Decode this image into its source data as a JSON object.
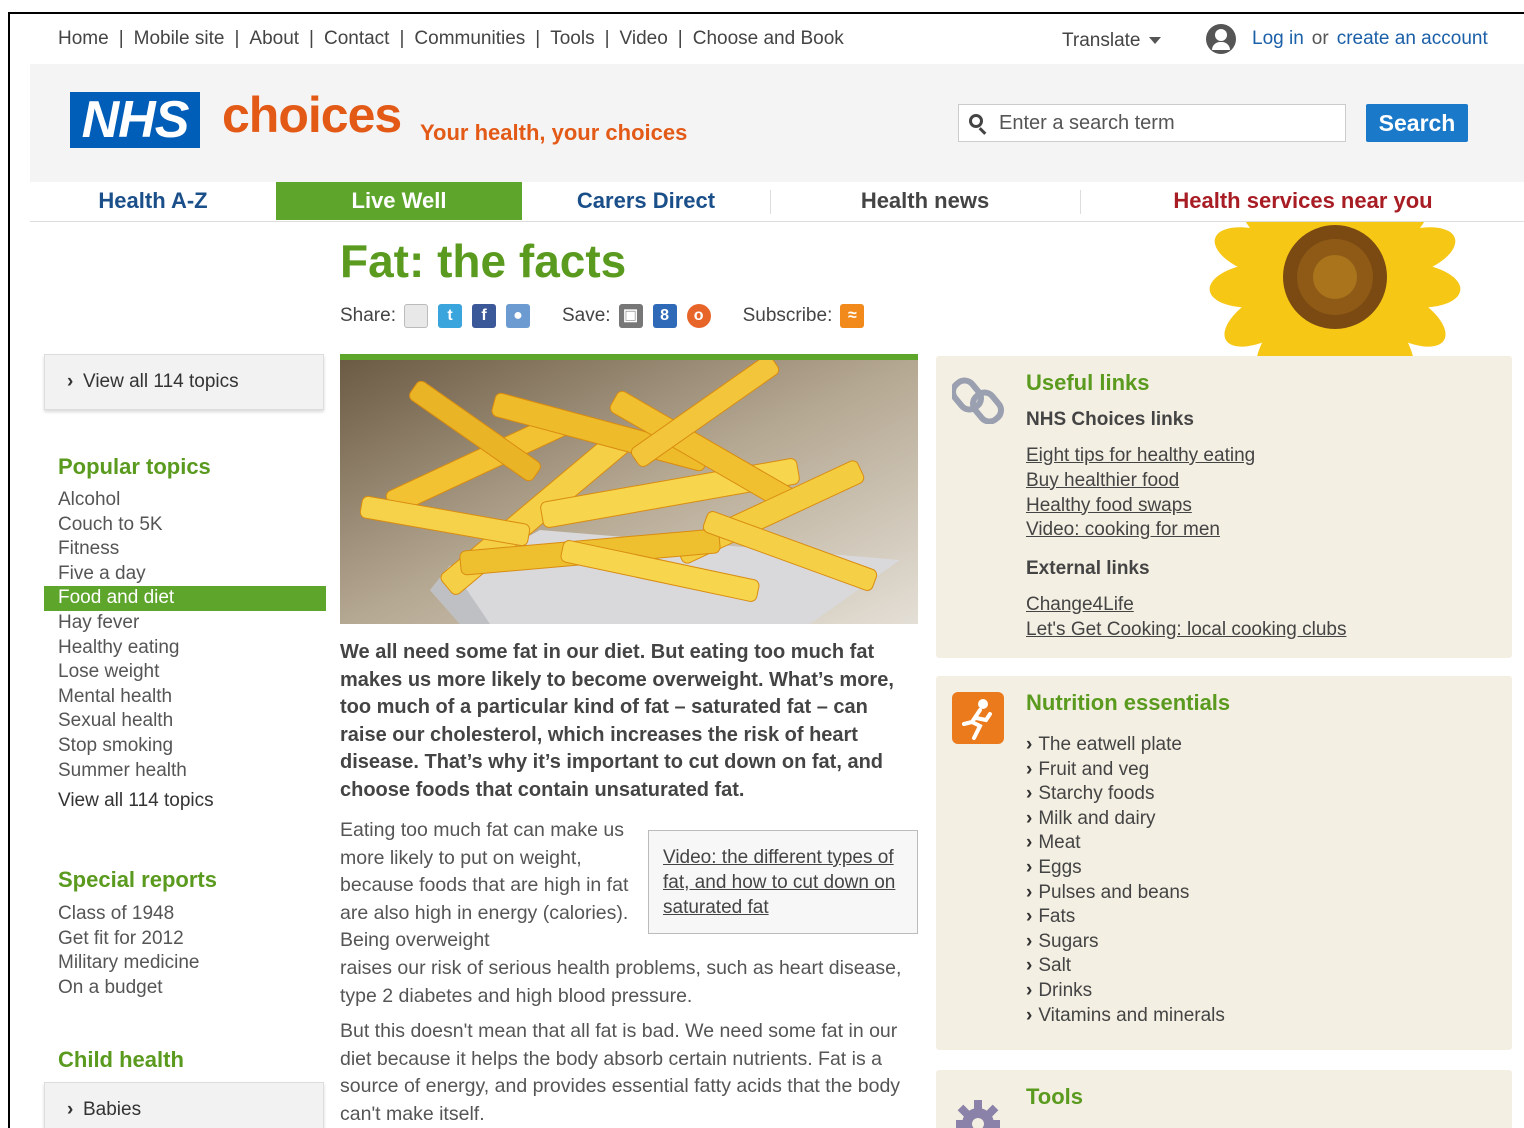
{
  "utility": {
    "links": [
      "Home",
      "Mobile site",
      "About",
      "Contact",
      "Communities",
      "Tools",
      "Video",
      "Choose and Book"
    ],
    "translate": "Translate",
    "login": "Log in",
    "or": "or",
    "create_account": "create an account"
  },
  "header": {
    "logo_nhs": "NHS",
    "logo_choices": "choices",
    "tagline": "Your health, your choices",
    "search_placeholder": "Enter a search term",
    "search_button": "Search"
  },
  "nav": {
    "items": [
      "Health A-Z",
      "Live Well",
      "Carers Direct",
      "Health news",
      "Health services near you"
    ],
    "active": "Live Well",
    "colors": {
      "accent_green": "#5ea52c",
      "nav_blue": "#1a4f8a",
      "services_red": "#a81c24"
    }
  },
  "page": {
    "title": "Fat: the facts",
    "share_label": "Share:",
    "save_label": "Save:",
    "subscribe_label": "Subscribe:"
  },
  "sidebar": {
    "view_all_top": "View all 114 topics",
    "popular_heading": "Popular topics",
    "popular": [
      "Alcohol",
      "Couch to 5K",
      "Fitness",
      "Five a day",
      "Food and diet",
      "Hay fever",
      "Healthy eating",
      "Lose weight",
      "Mental health",
      "Sexual health",
      "Stop smoking",
      "Summer health"
    ],
    "popular_active": "Food and diet",
    "view_all_bottom": "View all 114 topics",
    "special_heading": "Special reports",
    "special": [
      "Class of 1948",
      "Get fit for 2012",
      "Military medicine",
      "On a budget"
    ],
    "child_heading": "Child health",
    "babies": "Babies"
  },
  "article": {
    "intro": "We all need some fat in our diet. But eating too much fat makes us more likely to become overweight. What’s more, too much of a particular kind of fat – saturated fat – can raise our cholesterol, which increases the risk of heart disease. That’s why it’s important to cut down on fat, and choose foods that contain unsaturated fat.",
    "para1_wrapped": "Eating too much fat can make us more likely to put on weight, because foods that are high in fat are also high in energy (calories). Being overweight",
    "para1_rest": "raises our risk of serious health problems, such as heart disease, type 2 diabetes and high blood pressure.",
    "video_link": "Video: the different types of fat, and how to cut down on saturated fat",
    "para2": "But this doesn't mean that all fat is bad. We need some fat in our diet because it helps the body absorb certain nutrients. Fat is a source of energy, and provides essential fatty acids that the body can't make itself."
  },
  "useful_links": {
    "title": "Useful links",
    "nhs_heading": "NHS Choices links",
    "nhs_links": [
      "Eight tips for healthy eating",
      "Buy healthier food",
      "Healthy food swaps",
      "Video: cooking for men"
    ],
    "external_heading": "External links",
    "external_links": [
      "Change4Life",
      "Let's Get Cooking: local cooking clubs"
    ]
  },
  "nutrition": {
    "title": "Nutrition essentials",
    "items": [
      "The eatwell plate",
      "Fruit and veg",
      "Starchy foods",
      "Milk and dairy",
      "Meat",
      "Eggs",
      "Pulses and beans",
      "Fats",
      "Sugars",
      "Salt",
      "Drinks",
      "Vitamins and minerals"
    ]
  },
  "tools": {
    "title": "Tools"
  }
}
